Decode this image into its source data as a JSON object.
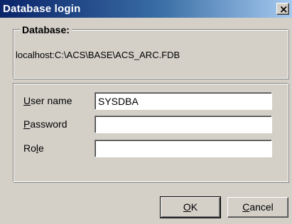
{
  "window": {
    "title": "Database login",
    "close_glyph": "×"
  },
  "database_group": {
    "legend": "Database:",
    "path": "localhost:C:\\ACS\\BASE\\ACS_ARC.FDB"
  },
  "fields": {
    "user_name": {
      "label_pre": "",
      "label_mnemonic": "U",
      "label_post": "ser name",
      "value": "SYSDBA"
    },
    "password": {
      "label_pre": "",
      "label_mnemonic": "P",
      "label_post": "assword",
      "value": ""
    },
    "role": {
      "label_pre": "Ro",
      "label_mnemonic": "l",
      "label_post": "e",
      "value": ""
    }
  },
  "buttons": {
    "ok": {
      "mnemonic": "O",
      "rest": "K"
    },
    "cancel": {
      "mnemonic": "C",
      "rest": "ancel"
    }
  }
}
